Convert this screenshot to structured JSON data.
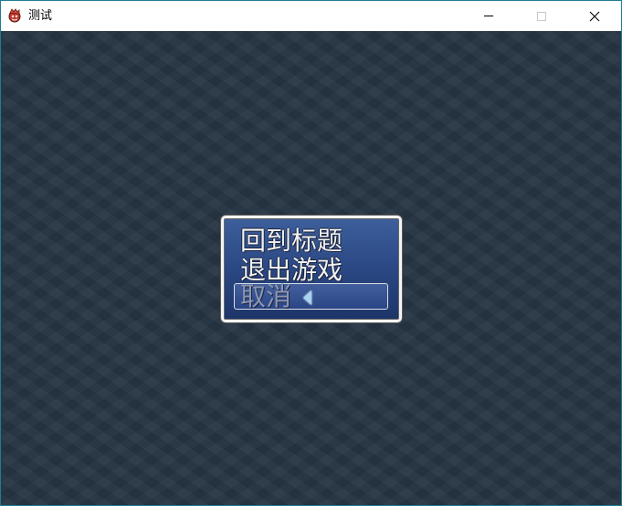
{
  "window": {
    "title": "测试",
    "icon": "game-app-icon"
  },
  "controls": {
    "minimize_icon": "minimize-icon",
    "maximize_icon": "maximize-icon",
    "close_icon": "close-icon"
  },
  "menu": {
    "items": [
      {
        "label": "回到标题",
        "state": "normal"
      },
      {
        "label": "退出游戏",
        "state": "normal"
      },
      {
        "label": "取消",
        "state": "selected-dimmed"
      }
    ],
    "selected_index": 2,
    "cursor_icon": "left-arrow-icon"
  },
  "colors": {
    "titlebar": "#ffffff",
    "window_border": "#1e7d96",
    "background": "#273544",
    "menu_top": "#3d5f9c",
    "menu_bottom": "#1d3468",
    "menu_border": "#f4f4f4",
    "text": "#f2f2f2",
    "dim_text": "#8d97b3",
    "arrow": "#a9d4f2"
  }
}
